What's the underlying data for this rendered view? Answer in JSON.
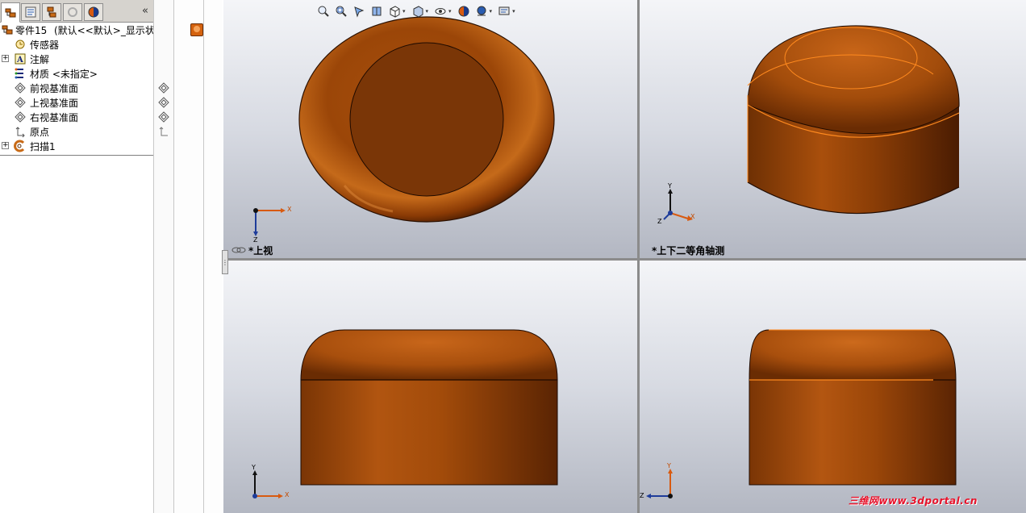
{
  "panel": {
    "tabs": [
      {
        "name": "featuremanager-tab"
      },
      {
        "name": "propertymanager-tab"
      },
      {
        "name": "configurationmanager-tab"
      },
      {
        "name": "dimxpert-tab"
      },
      {
        "name": "display-manager-tab"
      }
    ],
    "collapse_label": "«",
    "tree": {
      "root": {
        "label": "零件15",
        "config": "(默认<<默认>_显示状态"
      },
      "items": [
        {
          "label": "传感器",
          "expandable": false
        },
        {
          "label": "注解",
          "expandable": true
        },
        {
          "label": "材质 <未指定>",
          "expandable": false
        },
        {
          "label": "前视基准面",
          "expandable": false
        },
        {
          "label": "上视基准面",
          "expandable": false
        },
        {
          "label": "右视基准面",
          "expandable": false
        },
        {
          "label": "原点",
          "expandable": false
        },
        {
          "label": "扫描1",
          "expandable": true
        }
      ]
    }
  },
  "viewports": {
    "top": {
      "label": "*上视"
    },
    "iso": {
      "label": "*上下二等角轴测"
    },
    "front": {
      "label": ""
    },
    "right": {
      "label": ""
    }
  },
  "triad_labels": {
    "x": "X",
    "y": "Y",
    "z": "Z"
  },
  "hud": {
    "buttons": [
      "zoom-to-fit",
      "zoom-to-area",
      "previous-view",
      "section-view",
      "view-orientation",
      "display-style",
      "hide-show-items",
      "edit-appearance",
      "apply-scene",
      "view-settings"
    ]
  },
  "colors": {
    "part": "#b4560a",
    "part_dark": "#6b2e05",
    "edge_highlight": "#ff8a1f",
    "background_top": "#f4f5f8",
    "background_bottom": "#b3b7c2"
  },
  "watermark": "三维网www.3dportal.cn"
}
